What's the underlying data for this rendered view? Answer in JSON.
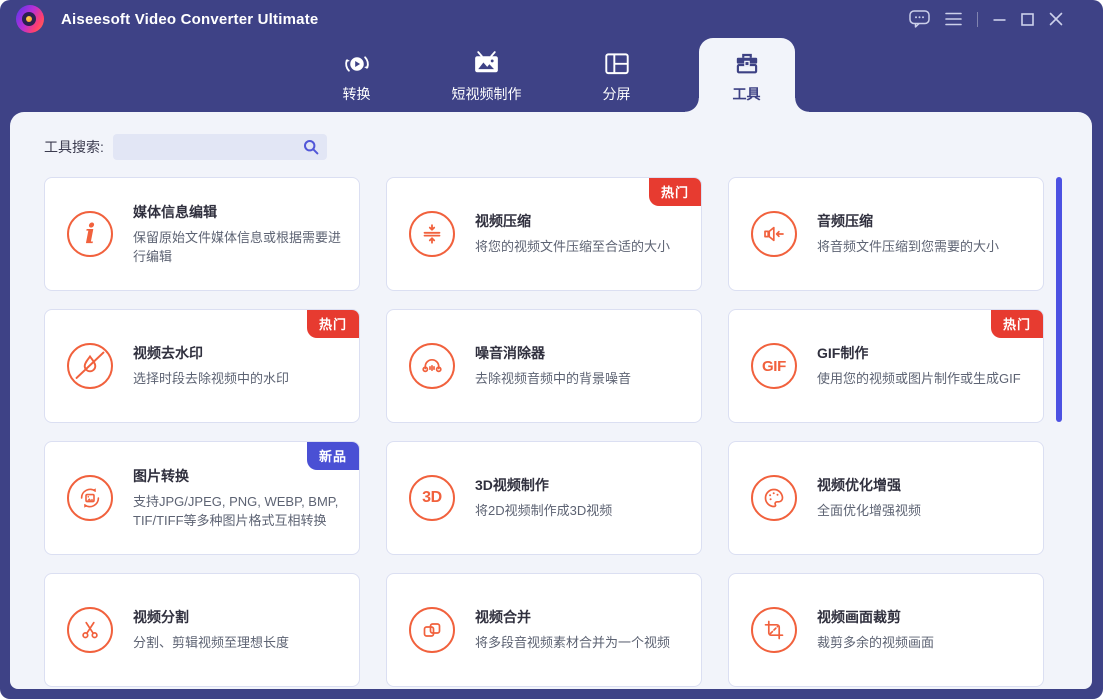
{
  "header": {
    "app_title": "Aiseesoft Video Converter Ultimate",
    "controls": {
      "feedback": "feedback",
      "menu": "menu",
      "minimize": "minimize",
      "maximize": "maximize",
      "close": "close"
    }
  },
  "tabs": [
    {
      "label": "转换",
      "active": false
    },
    {
      "label": "短视频制作",
      "active": false
    },
    {
      "label": "分屏",
      "active": false
    },
    {
      "label": "工具",
      "active": true
    }
  ],
  "search": {
    "label": "工具搜索:",
    "value": "",
    "icon": "search-icon"
  },
  "colors": {
    "header_bg": "#3e4286",
    "panel_bg": "#f2f4fa",
    "accent_orange": "#f1613d",
    "hot_badge": "#e73b30",
    "new_badge": "#4a50d4",
    "scrollbar": "#4c51e2"
  },
  "tools": [
    {
      "name": "媒体信息编辑",
      "desc": "保留原始文件媒体信息或根据需要进行编辑",
      "badge": "",
      "icon": "info-icon",
      "icon_label": "i"
    },
    {
      "name": "视频压缩",
      "desc": "将您的视频文件压缩至合适的大小",
      "badge": "热门",
      "icon": "compress-icon"
    },
    {
      "name": "音频压缩",
      "desc": "将音频文件压缩到您需要的大小",
      "badge": "",
      "icon": "audio-compress-icon"
    },
    {
      "name": "视频去水印",
      "desc": "选择时段去除视频中的水印",
      "badge": "热门",
      "icon": "watermark-remove-icon"
    },
    {
      "name": "噪音消除器",
      "desc": "去除视频音频中的背景噪音",
      "badge": "",
      "icon": "headphones-icon"
    },
    {
      "name": "GIF制作",
      "desc": "使用您的视频或图片制作或生成GIF",
      "badge": "热门",
      "icon": "gif-icon",
      "icon_label": "GIF"
    },
    {
      "name": "图片转换",
      "desc": "支持JPG/JPEG, PNG, WEBP, BMP, TIF/TIFF等多种图片格式互相转换",
      "badge": "新品",
      "icon": "image-convert-icon"
    },
    {
      "name": "3D视频制作",
      "desc": "将2D视频制作成3D视频",
      "badge": "",
      "icon": "3d-icon",
      "icon_label": "3D"
    },
    {
      "name": "视频优化增强",
      "desc": "全面优化增强视频",
      "badge": "",
      "icon": "palette-icon"
    },
    {
      "name": "视频分割",
      "desc": "分割、剪辑视频至理想长度",
      "badge": "",
      "icon": "scissors-icon"
    },
    {
      "name": "视频合并",
      "desc": "将多段音视频素材合并为一个视频",
      "badge": "",
      "icon": "merge-icon"
    },
    {
      "name": "视频画面裁剪",
      "desc": "裁剪多余的视频画面",
      "badge": "",
      "icon": "crop-icon"
    }
  ]
}
